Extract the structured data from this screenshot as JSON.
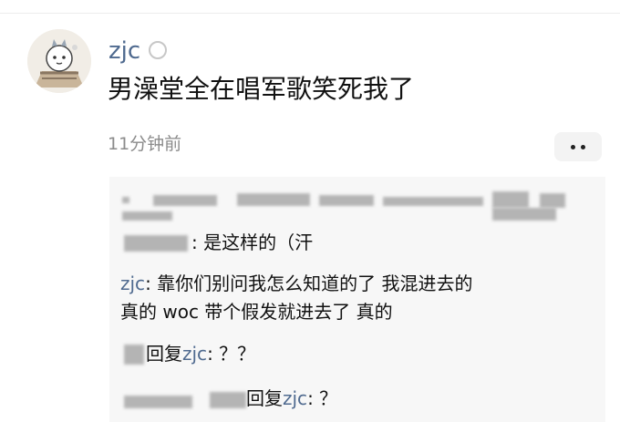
{
  "post": {
    "username": "zjc",
    "text": "男澡堂全在唱军歌笑死我了",
    "time": "11分钟前"
  },
  "comments": {
    "c2_text": ": 是这样的（汗",
    "c3_name": "zjc",
    "c3_text_l1": ": 靠你们别问我怎么知道的了 我混进去的",
    "c3_text_l2": "真的 woc 带个假发就进去了 真的",
    "c4_reply": "回复",
    "c4_target": "zjc",
    "c4_text": ": ？？",
    "c5_reply": "回复",
    "c5_target": "zjc",
    "c5_text": ": ？"
  },
  "icons": {
    "avatar": "cartoon-avatar",
    "badge": "circle-badge-icon",
    "more": "more-dots-icon"
  },
  "colors": {
    "link": "#4f6a8f",
    "time": "#8b8b8b",
    "comment_bg": "#f7f7f7"
  }
}
